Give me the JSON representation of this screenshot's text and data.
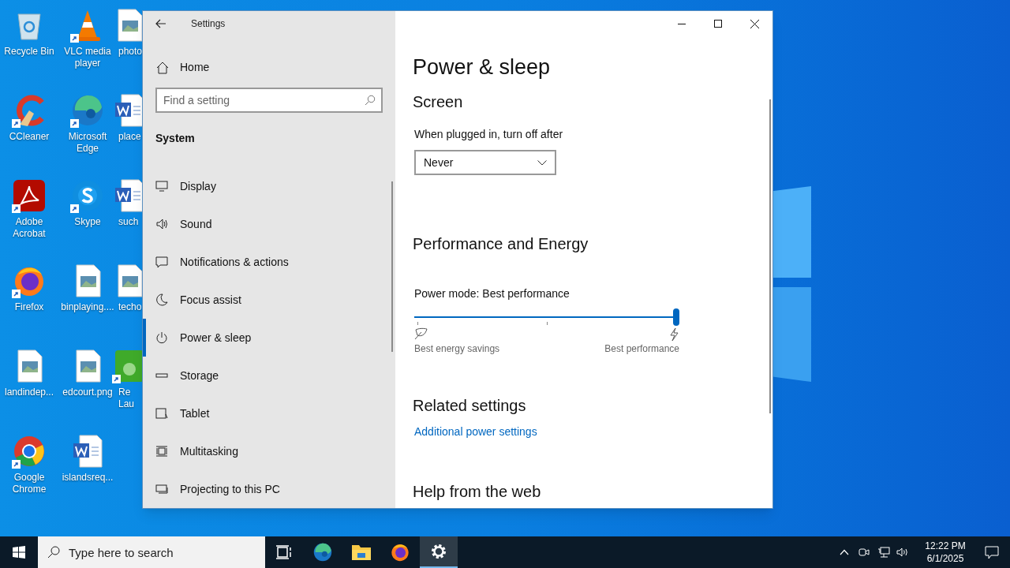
{
  "desktop": {
    "icons": [
      {
        "label": "Recycle Bin",
        "kind": "recycle",
        "shortcut": false
      },
      {
        "label": "VLC media player",
        "kind": "vlc",
        "shortcut": true
      },
      {
        "label": "photo",
        "kind": "image",
        "shortcut": false
      },
      {
        "label": "CCleaner",
        "kind": "ccleaner",
        "shortcut": true
      },
      {
        "label": "Microsoft Edge",
        "kind": "edge",
        "shortcut": true
      },
      {
        "label": "place",
        "kind": "word",
        "shortcut": false
      },
      {
        "label": "Adobe Acrobat",
        "kind": "acrobat",
        "shortcut": true
      },
      {
        "label": "Skype",
        "kind": "skype",
        "shortcut": true
      },
      {
        "label": "such",
        "kind": "word",
        "shortcut": false
      },
      {
        "label": "Firefox",
        "kind": "firefox",
        "shortcut": true
      },
      {
        "label": "binplaying....",
        "kind": "image",
        "shortcut": false
      },
      {
        "label": "techo",
        "kind": "image",
        "shortcut": false
      },
      {
        "label": "landindep...",
        "kind": "image",
        "shortcut": false
      },
      {
        "label": "edcourt.png",
        "kind": "image",
        "shortcut": false
      },
      {
        "label": "Re Lau",
        "kind": "app",
        "shortcut": true
      },
      {
        "label": "Google Chrome",
        "kind": "chrome",
        "shortcut": true
      },
      {
        "label": "islandsreq...",
        "kind": "word",
        "shortcut": false
      }
    ]
  },
  "window": {
    "title": "Settings",
    "sidebar": {
      "home": "Home",
      "search": {
        "placeholder": "Find a setting"
      },
      "section": "System",
      "items": [
        {
          "label": "Display",
          "selected": false
        },
        {
          "label": "Sound",
          "selected": false
        },
        {
          "label": "Notifications & actions",
          "selected": false
        },
        {
          "label": "Focus assist",
          "selected": false
        },
        {
          "label": "Power & sleep",
          "selected": true
        },
        {
          "label": "Storage",
          "selected": false
        },
        {
          "label": "Tablet",
          "selected": false
        },
        {
          "label": "Multitasking",
          "selected": false
        },
        {
          "label": "Projecting to this PC",
          "selected": false
        }
      ]
    },
    "content": {
      "heading": "Power & sleep",
      "screen": {
        "title": "Screen",
        "label": "When plugged in, turn off after",
        "value": "Never"
      },
      "performance": {
        "title": "Performance and Energy",
        "label": "Power mode: Best performance",
        "level": 1,
        "min_label": "Best energy savings",
        "max_label": "Best performance"
      },
      "related": {
        "title": "Related settings",
        "link": "Additional power settings"
      },
      "help": {
        "title": "Help from the web"
      }
    }
  },
  "taskbar": {
    "search": {
      "placeholder": "Type here to search"
    },
    "apps": [
      {
        "kind": "taskview",
        "selected": false
      },
      {
        "kind": "edge",
        "selected": false
      },
      {
        "kind": "explorer",
        "selected": false
      },
      {
        "kind": "firefox",
        "selected": false
      },
      {
        "kind": "settings",
        "selected": true
      }
    ],
    "time": "12:22 PM",
    "date": "6/1/2025"
  }
}
